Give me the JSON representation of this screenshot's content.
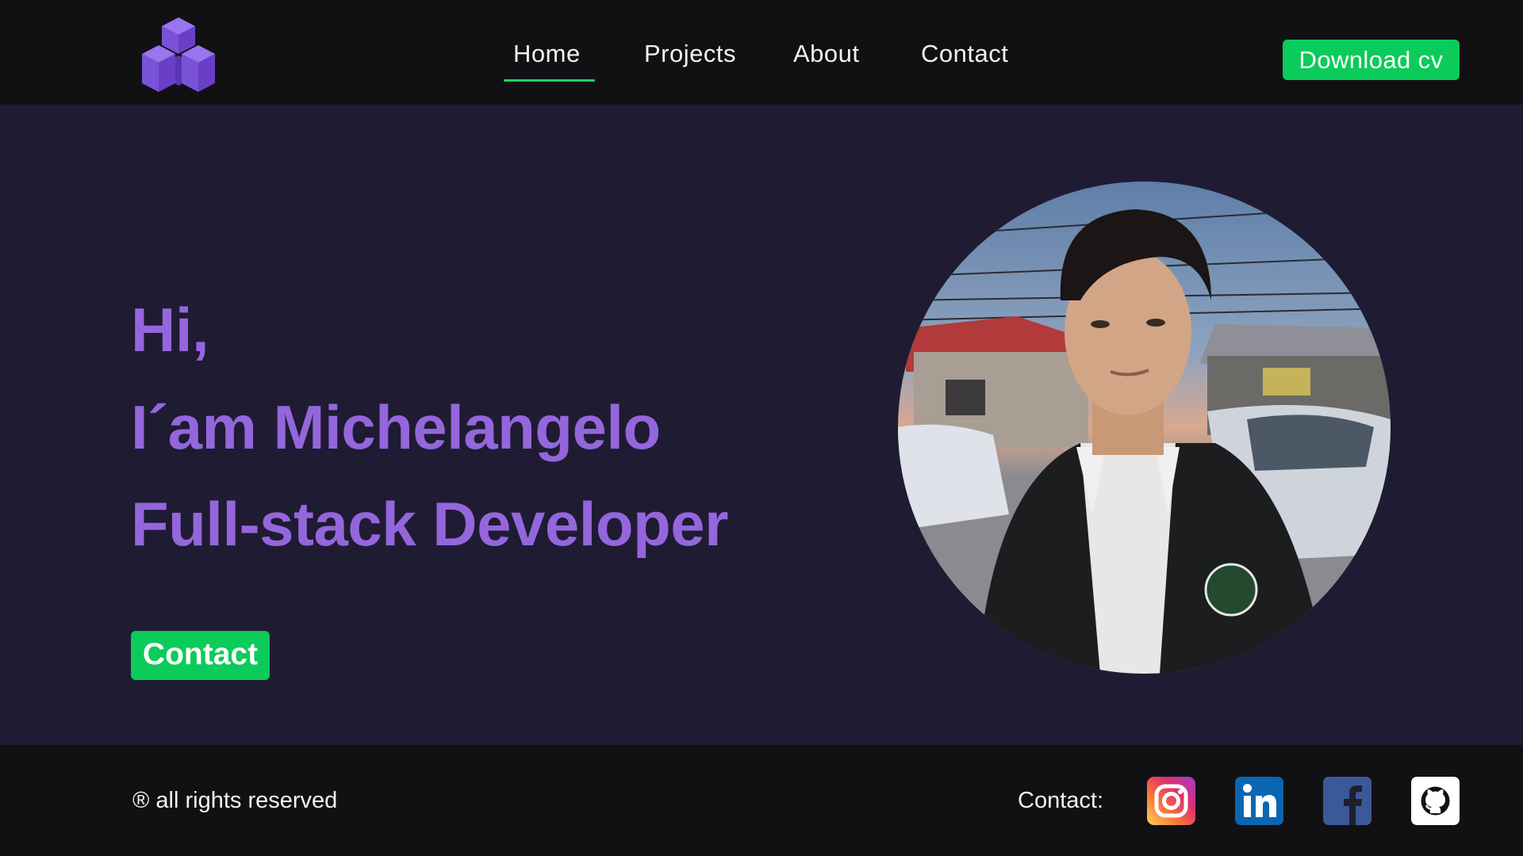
{
  "header": {
    "logo_icon": "cubes-logo-icon",
    "nav": [
      {
        "label": "Home",
        "active": true
      },
      {
        "label": "Projects",
        "active": false
      },
      {
        "label": "About",
        "active": false
      },
      {
        "label": "Contact",
        "active": false
      }
    ],
    "download_label": "Download cv"
  },
  "hero": {
    "greeting": "Hi,",
    "name_line": "I´am Michelangelo",
    "role_line": "Full-stack Developer",
    "contact_label": "Contact",
    "portrait_icon": "profile-photo"
  },
  "footer": {
    "rights": "® all rights reserved",
    "contact_label": "Contact:",
    "social_icons": [
      "instagram-icon",
      "linkedin-icon",
      "facebook-icon",
      "github-icon"
    ]
  },
  "colors": {
    "accent_green": "#0bcb5a",
    "heading_purple": "#9466dc",
    "hero_bg": "#1f1b33",
    "bar_bg": "#111114"
  }
}
